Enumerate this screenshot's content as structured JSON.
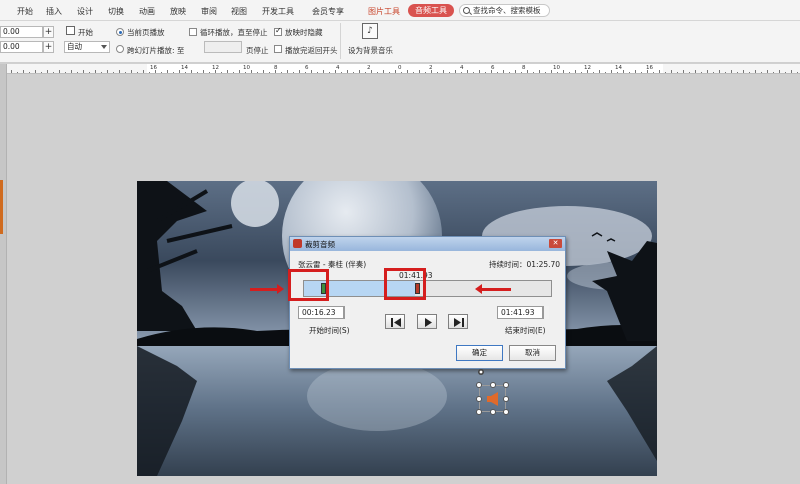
{
  "menu": {
    "tabs": [
      "开始",
      "插入",
      "设计",
      "切换",
      "动画",
      "放映",
      "审阅",
      "视图",
      "开发工具",
      "会员专享"
    ],
    "picture_tools": "图片工具",
    "audio_tools": "音频工具",
    "search_placeholder": "查找命令、搜索模板"
  },
  "ribbon": {
    "volume_value": "0.00",
    "fade_value": "0.00",
    "start_label": "开始",
    "start_select": "自动",
    "current_page": "当前页播放",
    "cross_slides": "跨幻灯片播放: 至",
    "page_stop": "页停止",
    "loop_play": "循环播放，直至停止",
    "hide_when_playing": "放映时隐藏",
    "rewind_after_play": "播放完返回开头",
    "set_bg_music": "设为背景音乐"
  },
  "ruler": {
    "labels": [
      "16",
      "14",
      "12",
      "10",
      "8",
      "6",
      "4",
      "2",
      "0",
      "2",
      "4",
      "6",
      "8",
      "10",
      "12",
      "14",
      "16"
    ]
  },
  "dialog": {
    "title": "裁剪音频",
    "track_name": "张云雷 - 秦桂 (伴奏)",
    "duration_label": "持续时间：01:25.70",
    "current_marker": "01:41.93",
    "start_time": "00:16.23",
    "start_label": "开始时间(S)",
    "end_time": "01:41.93",
    "end_label": "结束时间(E)",
    "ok": "确定",
    "cancel": "取消",
    "close_icon": "close-icon",
    "start_fraction": 0.07,
    "end_fraction": 0.45
  },
  "colors": {
    "accent_red": "#d51e1e",
    "audio_tab": "#d9534f",
    "picture_tab_text": "#c8442a",
    "track_fill": "#b7d6f3"
  }
}
